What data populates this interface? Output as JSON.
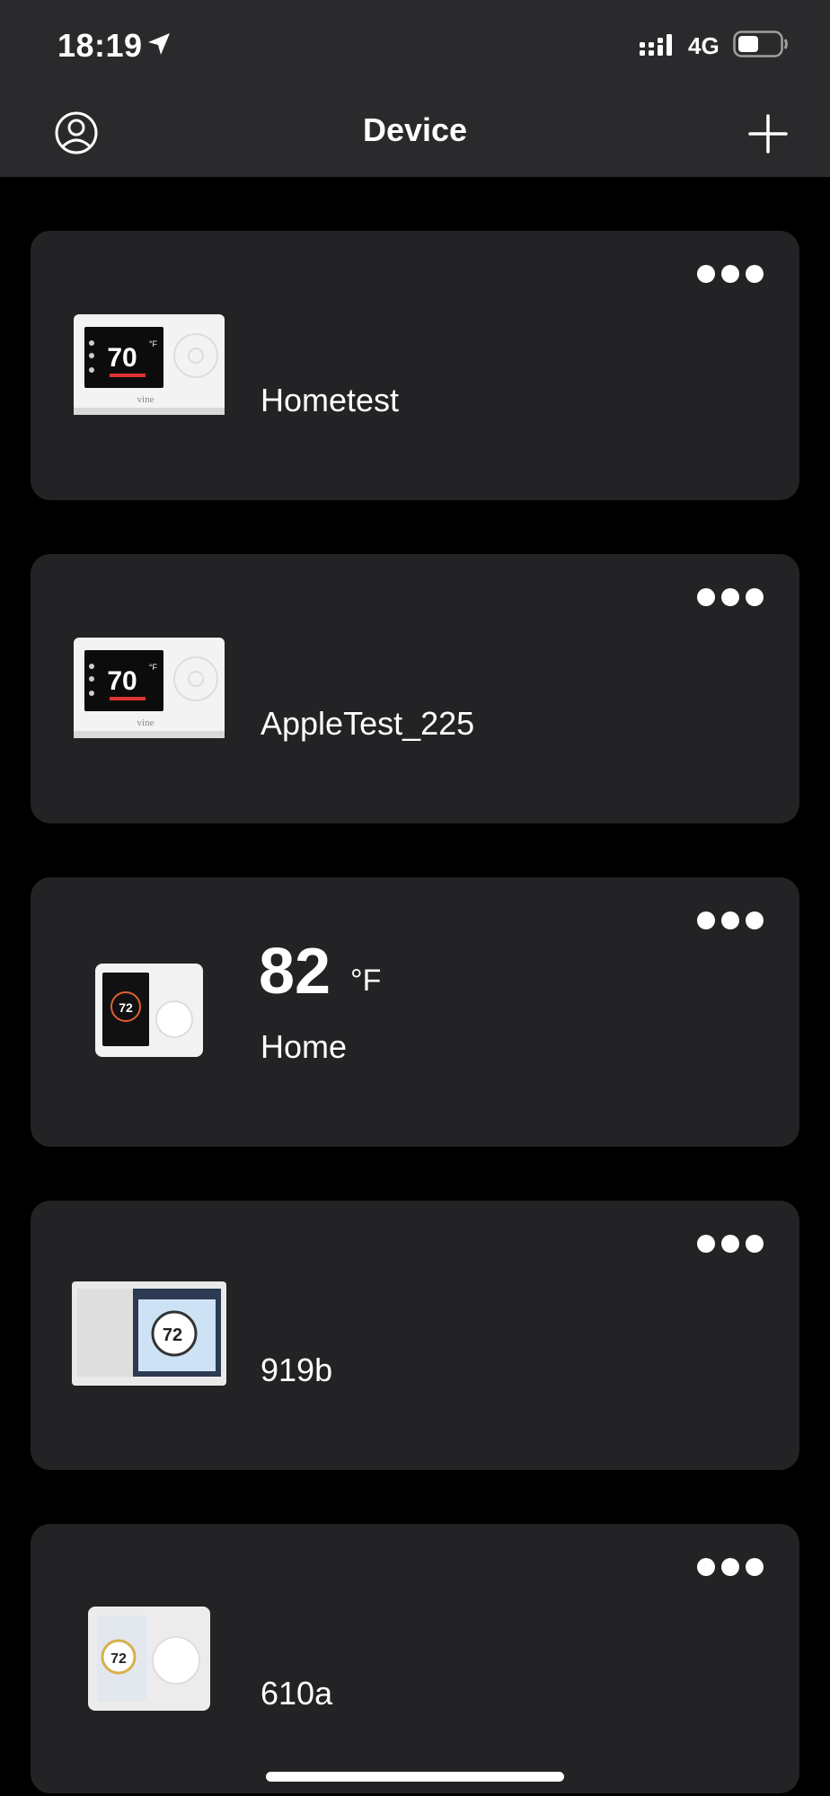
{
  "status_bar": {
    "time": "18:19",
    "network": "4G",
    "icons": [
      "location-arrow-icon",
      "signal-icon",
      "battery-icon"
    ]
  },
  "header": {
    "title": "Device",
    "left_icon": "profile-icon",
    "right_icon": "add-icon"
  },
  "colors": {
    "background": "#000000",
    "header_bg": "#2a2a2c",
    "card_bg": "#232325",
    "text": "#ffffff"
  },
  "devices": [
    {
      "name": "Hometest",
      "thumbnail": "vine-thermostat-black-screen",
      "thumb_temp": "70",
      "thumb_unit": "°F"
    },
    {
      "name": "AppleTest_225",
      "thumbnail": "vine-thermostat-black-screen",
      "thumb_temp": "70",
      "thumb_unit": "°F"
    },
    {
      "name": "Home",
      "temperature": "82",
      "unit": "°F",
      "thumbnail": "vine-round-thermostat",
      "thumb_temp": "72"
    },
    {
      "name": "919b",
      "thumbnail": "vine-wide-thermostat",
      "thumb_temp": "72"
    },
    {
      "name": "610a",
      "thumbnail": "vine-square-thermostat",
      "thumb_temp": "72"
    }
  ]
}
